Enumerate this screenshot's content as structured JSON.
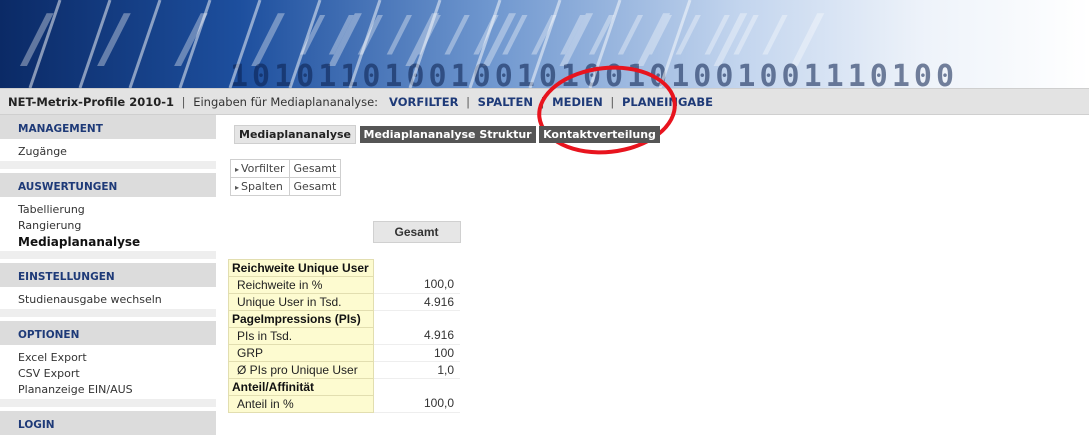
{
  "banner": {
    "binary_text": "101011010010010100101001001110100"
  },
  "navbar": {
    "title": "NET-Metrix-Profile 2010-1",
    "separator": "|",
    "intro": "Eingaben für Mediaplananalyse:",
    "links": [
      "VORFILTER",
      "SPALTEN",
      "MEDIEN",
      "PLANEINGABE"
    ]
  },
  "sidebar": {
    "sections": [
      {
        "heading": "MANAGEMENT",
        "items": [
          "Zugänge"
        ]
      },
      {
        "heading": "AUSWERTUNGEN",
        "items": [
          "Tabellierung",
          "Rangierung",
          "Mediaplananalyse"
        ]
      },
      {
        "heading": "EINSTELLUNGEN",
        "items": [
          "Studienausgabe wechseln"
        ]
      },
      {
        "heading": "OPTIONEN",
        "items": [
          "Excel Export",
          "CSV Export",
          "Plananzeige EIN/AUS"
        ]
      },
      {
        "heading": "LOGIN",
        "items": []
      }
    ],
    "active_item": "Mediaplananalyse"
  },
  "tabs": [
    "Mediaplananalyse",
    "Mediaplananalyse Struktur",
    "Kontaktverteilung"
  ],
  "filters": [
    {
      "label": "Vorfilter",
      "value": "Gesamt"
    },
    {
      "label": "Spalten",
      "value": "Gesamt"
    }
  ],
  "table": {
    "column_header": "Gesamt",
    "sections": [
      {
        "title": "Reichweite Unique User",
        "rows": [
          {
            "label": "Reichweite in %",
            "value": "100,0"
          },
          {
            "label": "Unique User in Tsd.",
            "value": "4.916"
          }
        ]
      },
      {
        "title": "PageImpressions (PIs)",
        "rows": [
          {
            "label": "PIs in Tsd.",
            "value": "4.916"
          },
          {
            "label": "GRP",
            "value": "100"
          },
          {
            "label": "Ø PIs pro Unique User",
            "value": "1,0"
          }
        ]
      },
      {
        "title": "Anteil/Affinität",
        "rows": [
          {
            "label": "Anteil in %",
            "value": "100,0"
          }
        ]
      }
    ]
  },
  "colors": {
    "nav_link": "#1e3a78",
    "highlight": "#e8141e",
    "section_fill": "#fdfbd0"
  }
}
